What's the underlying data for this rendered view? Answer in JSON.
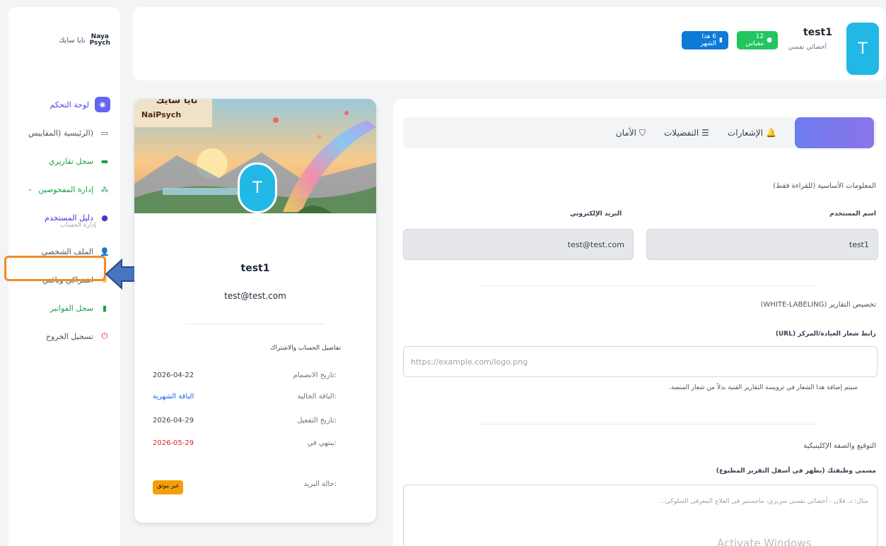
{
  "sidebar": {
    "logo_mark": "Naya\nPsych",
    "logo_text": "نايا سايك",
    "items": [
      {
        "label": "لوحة التحكم",
        "icon": "dashboard-icon"
      },
      {
        "label": "(الرئيسية (المقاييس",
        "icon": "monitor-icon"
      },
      {
        "label": "سجل تقاريري",
        "icon": "folder-icon"
      },
      {
        "label": "إدارة المفحوصين",
        "icon": "users-icon"
      },
      {
        "label": "دليل المستخدم",
        "icon": "info-icon"
      },
      {
        "label": "الملف الشخصي",
        "icon": "user-icon"
      },
      {
        "label": "اشتراكي وباقتي",
        "icon": "crown-icon"
      },
      {
        "label": "سجل الفواتير",
        "icon": "invoice-icon"
      },
      {
        "label": "تسجيل الخروج",
        "icon": "power-icon"
      }
    ],
    "section_label": "إدارة الحساب",
    "users_caret": "⌄"
  },
  "header": {
    "avatar_letter": "T",
    "name": "test1",
    "role": "أخصائي نفسي",
    "badge_scales": "12 مقياس",
    "badge_month": "6 هذا الشهر"
  },
  "card": {
    "avatar_letter": "T",
    "banner_brand": "نايا سايك",
    "banner_brand_en": "NaiPsych",
    "name": "test1",
    "email": "test@test.com",
    "details_title": "تفاصيل الحساب والاشتراك",
    "rows": [
      {
        "key": "تاريخ الانضمام:",
        "value": "2026-04-22"
      },
      {
        "key": "الباقة الحالية:",
        "value": "الباقة الشهرية"
      },
      {
        "key": "تاريخ التفعيل:",
        "value": "2026-04-29"
      },
      {
        "key": "ينتهي في:",
        "value": "2026-05-29"
      },
      {
        "key": "حالة البريد:",
        "value": "غير موثق"
      }
    ]
  },
  "panel": {
    "tabs": [
      {
        "label": "الإشعارات",
        "icon": "bell-icon"
      },
      {
        "label": "التفضيلات",
        "icon": "sliders-icon"
      },
      {
        "label": "الأمان",
        "icon": "shield-icon"
      }
    ],
    "basic_info_title": "المعلومات الأساسية (للقراءة فقط)",
    "username_label": "اسم المستخدم",
    "username_value": "test1",
    "email_label": "البريد الإلكتروني",
    "email_value": "test@test.com",
    "branding_title": "تخصيص التقارير (WHITE-LABELING)",
    "logo_url_label": "رابط شعار العيادة/المركز (URL)",
    "logo_url_placeholder": "https://example.com/logo.png",
    "logo_hint": "سيتم إضافة هذا الشعار في ترويسة التقارير الفنية بدلاً من شعار المنصة.",
    "signature_title": "التوقيع والصفة الإكلينيكية",
    "signature_label": "مسمى وظيفتك (يظهر في أسفل التقرير المطبوع)",
    "signature_placeholder": "مثال: د. فلان - أخصائي نفسي سريري، ماجستير في العلاج المعرفي السلوكي...",
    "watermark": "Activate Windows"
  },
  "colors": {
    "accent": "#22b8e6",
    "highlight": "#f28c28",
    "arrow": "#4a73c0"
  }
}
